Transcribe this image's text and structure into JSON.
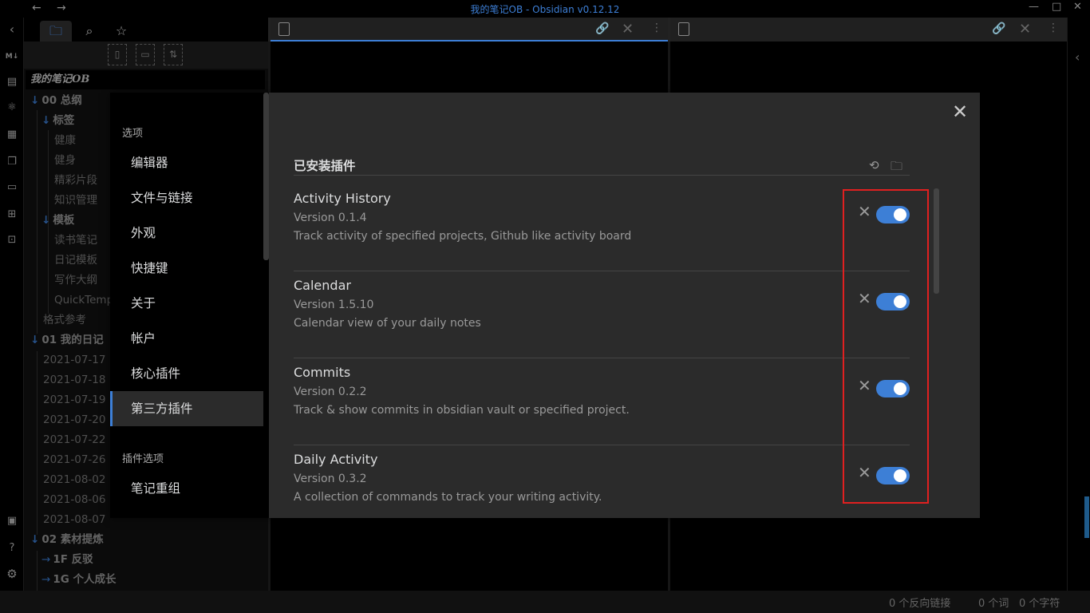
{
  "window": {
    "title": "我的笔记OB - Obsidian v0.12.12",
    "back": "←",
    "forward": "→",
    "minimize": "—",
    "maximize": "□",
    "close": "✕"
  },
  "ribbon": {
    "icons": [
      "markdown-icon",
      "import-icon",
      "graph-icon",
      "calendar-icon",
      "copy-icon",
      "slides-icon",
      "plugins-icon",
      "archive-icon",
      "vault-icon",
      "help-icon",
      "settings-icon"
    ]
  },
  "explorer": {
    "tabs": [
      "files",
      "search",
      "starred"
    ],
    "vault_name": "我的笔记OB",
    "tree": [
      {
        "label": "00 总纲",
        "type": "folder"
      },
      {
        "label": "标签",
        "type": "folder"
      },
      {
        "label": "健康",
        "type": "file"
      },
      {
        "label": "健身",
        "type": "file"
      },
      {
        "label": "精彩片段",
        "type": "file"
      },
      {
        "label": "知识管理",
        "type": "file"
      },
      {
        "label": "模板",
        "type": "folder"
      },
      {
        "label": "读书笔记",
        "type": "file"
      },
      {
        "label": "日记模板",
        "type": "file"
      },
      {
        "label": "写作大纲",
        "type": "file"
      },
      {
        "label": "QuickTemp",
        "type": "file"
      },
      {
        "label": "格式参考",
        "type": "file"
      },
      {
        "label": "01 我的日记",
        "type": "folder"
      },
      {
        "label": "2021-07-17",
        "type": "file"
      },
      {
        "label": "2021-07-18",
        "type": "file"
      },
      {
        "label": "2021-07-19",
        "type": "file"
      },
      {
        "label": "2021-07-20",
        "type": "file"
      },
      {
        "label": "2021-07-22",
        "type": "file"
      },
      {
        "label": "2021-07-26",
        "type": "file"
      },
      {
        "label": "2021-08-02",
        "type": "file"
      },
      {
        "label": "2021-08-06",
        "type": "file"
      },
      {
        "label": "2021-08-07",
        "type": "file"
      },
      {
        "label": "02 素材提炼",
        "type": "folder"
      },
      {
        "label": "1F 反驳",
        "type": "folder"
      },
      {
        "label": "1G 个人成长",
        "type": "folder"
      }
    ]
  },
  "statusbar": {
    "backlinks": "0 个反向链接",
    "words": "0 个词",
    "chars": "0 个字符"
  },
  "settings": {
    "options_heading": "选项",
    "nav": [
      "编辑器",
      "文件与链接",
      "外观",
      "快捷键",
      "关于",
      "帐户",
      "核心插件",
      "第三方插件"
    ],
    "active_nav_index": 7,
    "plugin_options_heading": "插件选项",
    "plugin_nav": [
      "笔记重组"
    ],
    "close_label": "✕",
    "installed_title": "已安装插件",
    "plugins": [
      {
        "name": "Activity History",
        "version": "Version 0.1.4",
        "description": "Track activity of specified projects, Github like activity board",
        "enabled": true
      },
      {
        "name": "Calendar",
        "version": "Version 1.5.10",
        "description": "Calendar view of your daily notes",
        "enabled": true
      },
      {
        "name": "Commits",
        "version": "Version 0.2.2",
        "description": "Track & show commits in obsidian vault or specified project.",
        "enabled": true
      },
      {
        "name": "Daily Activity",
        "version": "Version 0.3.2",
        "description": "A collection of commands to track your writing activity.",
        "enabled": true
      }
    ]
  },
  "colors": {
    "accent": "#3d7fd6",
    "highlight": "#e02020"
  }
}
